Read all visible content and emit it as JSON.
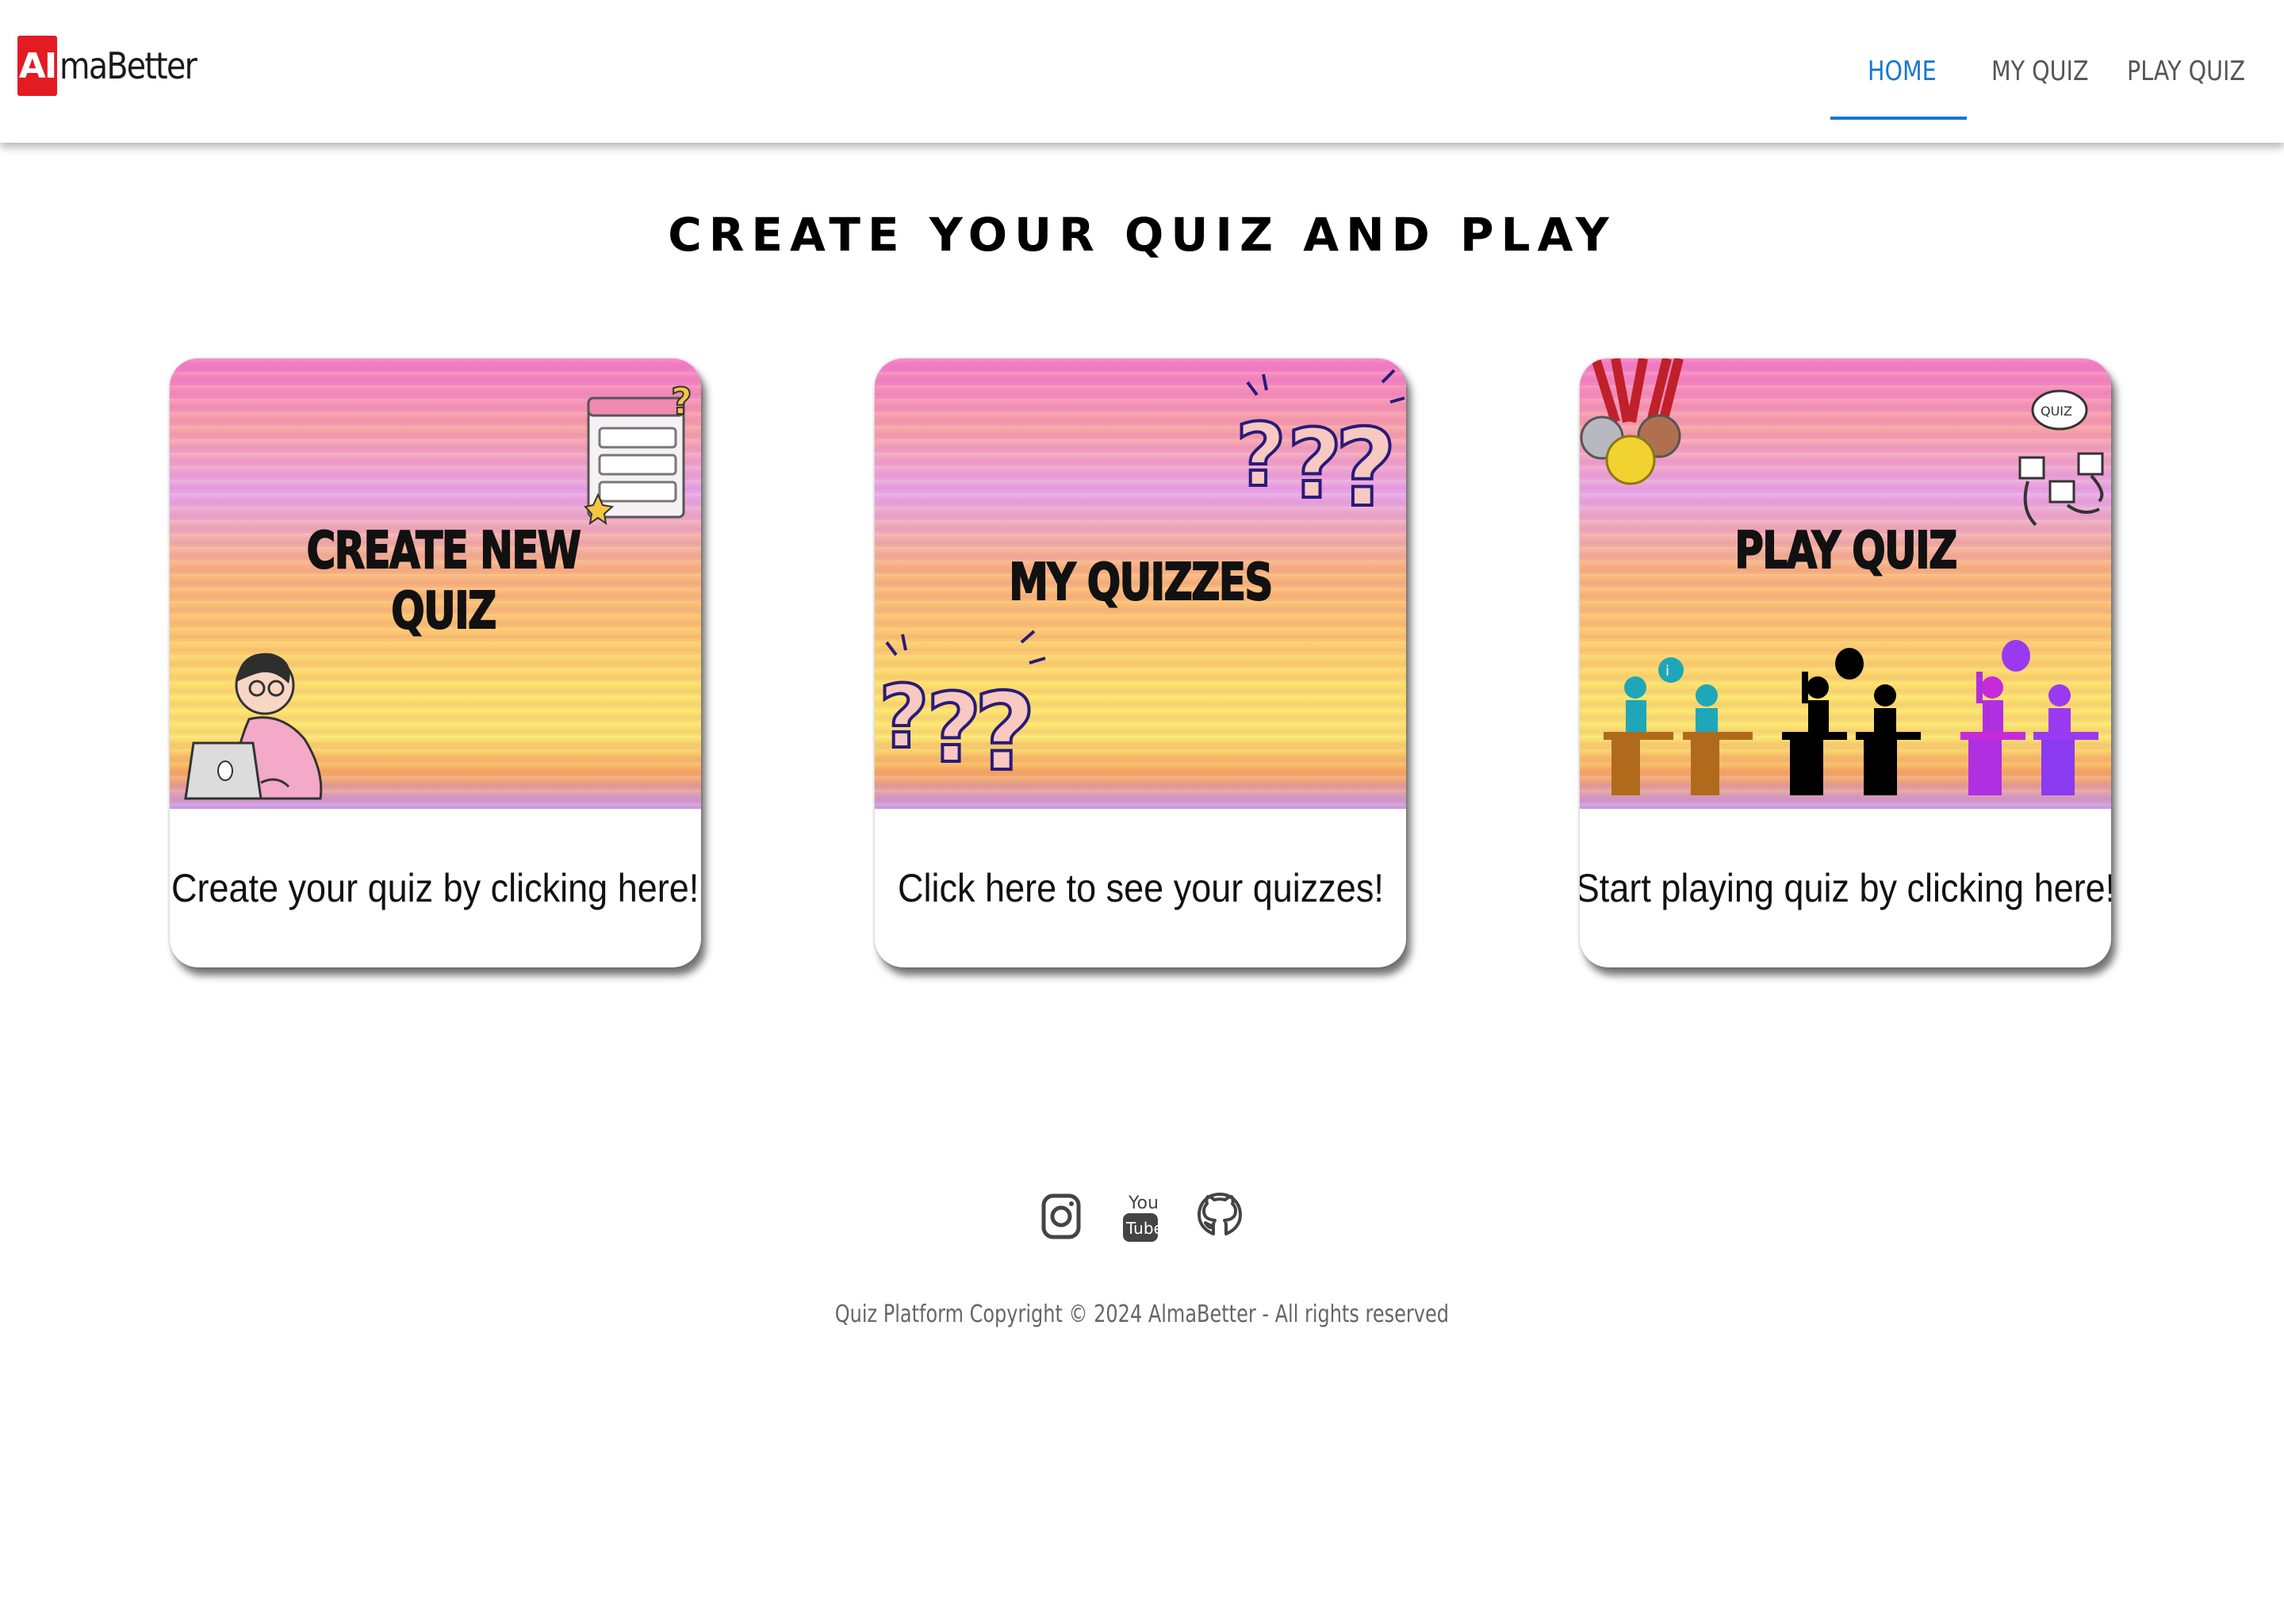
{
  "header": {
    "logo_mark": "AI",
    "logo_text": "maBetter",
    "nav": [
      {
        "label": "HOME",
        "active": true
      },
      {
        "label": "MY QUIZ",
        "active": false
      },
      {
        "label": "PLAY QUIZ",
        "active": false
      }
    ]
  },
  "main": {
    "title": "CREATE YOUR QUIZ AND PLAY",
    "cards": [
      {
        "heading_line1": "CREATE NEW",
        "heading_line2": "QUIZ",
        "text": "Create your quiz by clicking here!"
      },
      {
        "heading_line1": "MY QUIZZES",
        "heading_line2": "",
        "text": "Click here to see your quizzes!"
      },
      {
        "heading_line1": "PLAY QUIZ",
        "heading_line2": "",
        "text": "Start playing quiz by clicking here!"
      }
    ]
  },
  "footer": {
    "icons": [
      "instagram-icon",
      "youtube-icon",
      "github-icon"
    ],
    "youtube_top": "You",
    "youtube_bottom": "Tube",
    "copyright": "Quiz Platform Copyright © 2024 AlmaBetter - All rights reserved"
  },
  "colors": {
    "accent": "#1976d2",
    "logo_red": "#e31b23",
    "nav_text": "#555555",
    "footer_text": "#666666"
  }
}
